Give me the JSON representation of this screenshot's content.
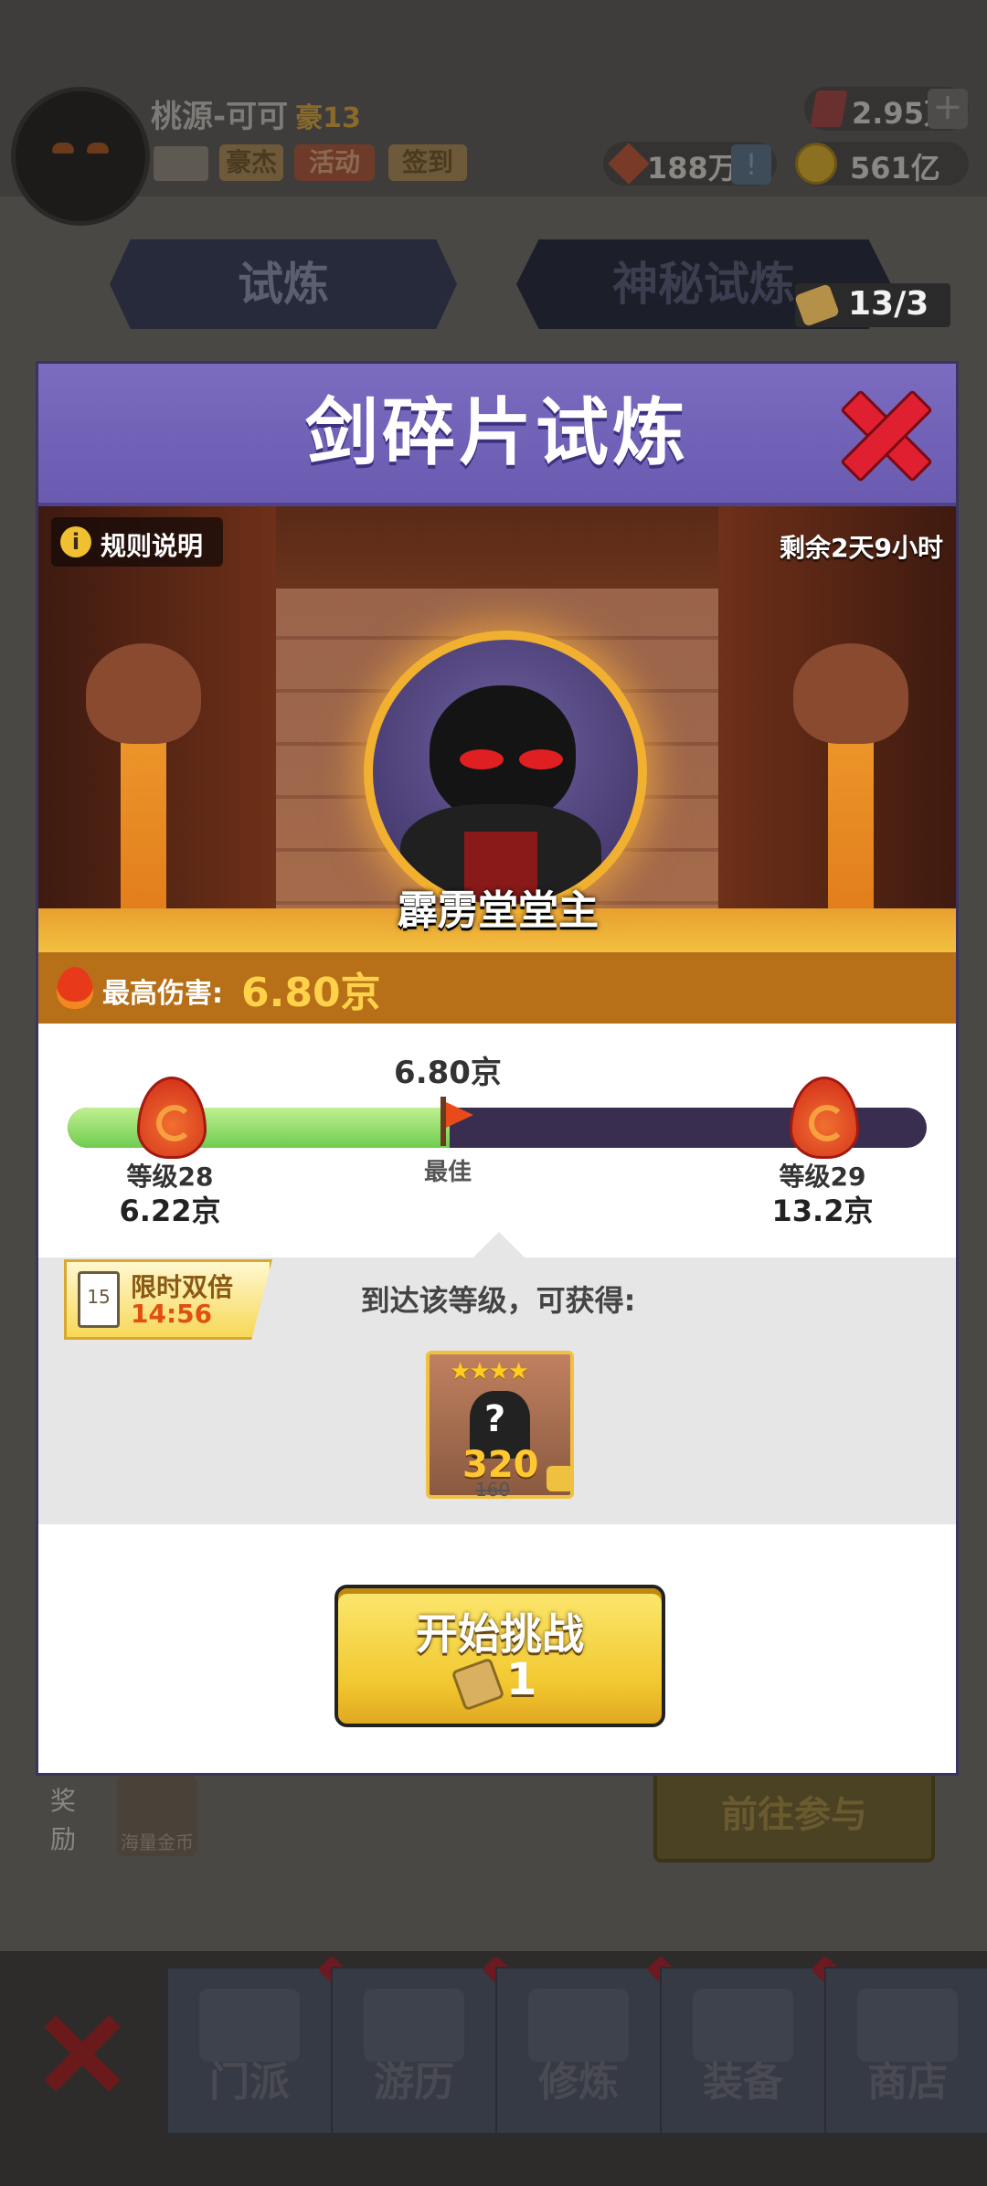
{
  "header": {
    "player_name": "桃源-可可",
    "player_rank": "豪13",
    "chips": {
      "hero": "豪杰",
      "event": "活动",
      "signin": "签到"
    },
    "currency": {
      "gems": "2.95万",
      "cash": "188万",
      "gold": "561亿"
    },
    "plus_label": "+",
    "alert_label": "!"
  },
  "tabs": [
    {
      "label": "试炼"
    },
    {
      "label": "神秘试炼"
    }
  ],
  "tickets": {
    "count": "13/3"
  },
  "background": {
    "reward_label": "奖励",
    "reward_item": "海量金币",
    "go_button": "前往参与"
  },
  "modal": {
    "title": "剑碎片试炼",
    "rules_label": "规则说明",
    "info_icon": "i",
    "time_remaining": "剩余2天9小时",
    "boss_name": "霹雳堂堂主",
    "max_damage_label": "最高伤害:",
    "max_damage_value": "6.80京",
    "progress": {
      "current_value": "6.80京",
      "fill_fraction": 0.445,
      "best_label": "最佳",
      "left_level": "等级28",
      "left_value": "6.22京",
      "right_level": "等级29",
      "right_value": "13.2京"
    },
    "double": {
      "label": "限时双倍",
      "timer": "14:56",
      "card_number": "15"
    },
    "reach_text": "到达该等级，可获得:",
    "reward": {
      "stars": "★★★★",
      "symbol": "?",
      "amount": "320",
      "old_amount": "160"
    },
    "start": {
      "label": "开始挑战",
      "cost": "1"
    }
  },
  "nav": [
    {
      "label": "门派"
    },
    {
      "label": "游历"
    },
    {
      "label": "修炼"
    },
    {
      "label": "装备"
    },
    {
      "label": "商店"
    }
  ],
  "colors": {
    "accent": "#6a5ab0",
    "damage": "#ffd24a",
    "progress_fill": "#70cc50",
    "close": "#e02030"
  }
}
